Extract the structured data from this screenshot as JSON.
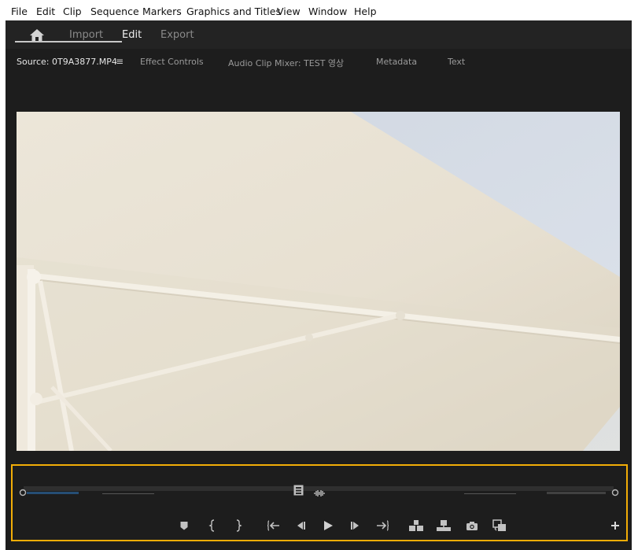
{
  "menu": [
    "File",
    "Edit",
    "Clip",
    "Sequence",
    "Markers",
    "Graphics and Titles",
    "View",
    "Window",
    "Help"
  ],
  "workspaces": {
    "import": "Import",
    "edit": "Edit",
    "export": "Export"
  },
  "panel_tabs": {
    "source": "Source: 0T9A3877.MP4",
    "effect_controls": "Effect Controls",
    "audio_clip_mixer": "Audio Clip Mixer: TEST 영상",
    "metadata": "Metadata",
    "text": "Text"
  },
  "colors": {
    "accent_highlight": "#f2ad07",
    "panel_bg": "#1d1d1d",
    "timecode_blue": "#2d6fb0"
  },
  "icons": [
    "home-icon",
    "panel-menu-icon",
    "drag-video-icon",
    "drag-audio-icon",
    "add-marker-icon",
    "mark-in-icon",
    "mark-out-icon",
    "go-to-in-icon",
    "step-back-icon",
    "play-icon",
    "step-forward-icon",
    "go-to-out-icon",
    "insert-icon",
    "overwrite-icon",
    "export-frame-icon",
    "button-editor-swap-icon",
    "add-button-icon"
  ]
}
